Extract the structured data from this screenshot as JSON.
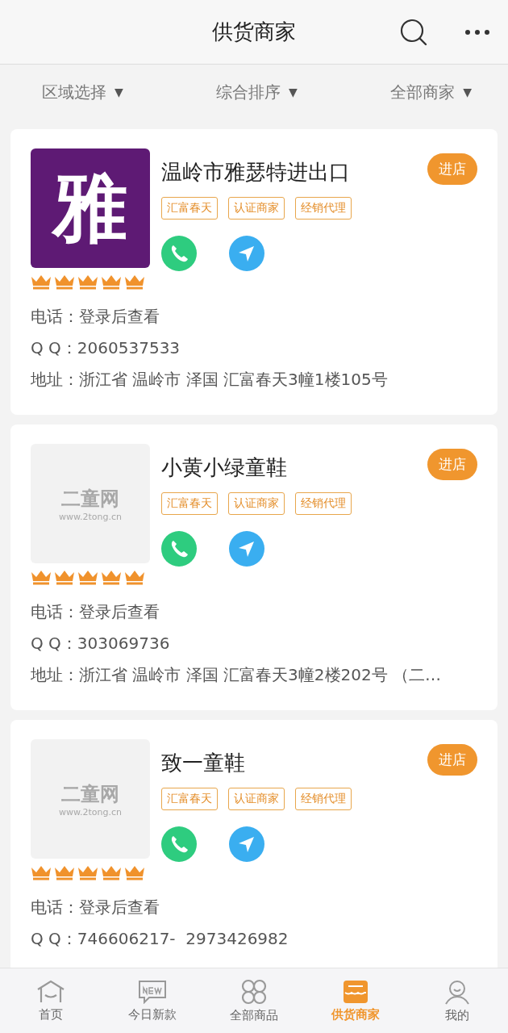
{
  "header": {
    "title": "供货商家"
  },
  "filters": [
    {
      "label": "区域选择",
      "arrow": "▼"
    },
    {
      "label": "综合排序",
      "arrow": "▼"
    },
    {
      "label": "全部商家",
      "arrow": "▼"
    }
  ],
  "shops": [
    {
      "logo": {
        "kind": "letter",
        "text": "雅",
        "color": "#5e1a74"
      },
      "name": "温岭市雅瑟特进出口",
      "enter": "进店",
      "tags": [
        "汇富春天",
        "认证商家",
        "经销代理"
      ],
      "stars": 5,
      "info": [
        {
          "label": "电话：",
          "value": "登录后查看"
        },
        {
          "label": "Q Q：",
          "value": "2060537533"
        },
        {
          "label": "地址：",
          "value": "浙江省 温岭市 泽国 汇富春天3幢1楼105号"
        }
      ]
    },
    {
      "logo": {
        "kind": "placeholder",
        "text": "二童网",
        "url": "www.2tong.cn"
      },
      "name": "小黄小绿童鞋",
      "enter": "进店",
      "tags": [
        "汇富春天",
        "认证商家",
        "经销代理"
      ],
      "stars": 5,
      "info": [
        {
          "label": "电话：",
          "value": "登录后查看"
        },
        {
          "label": "Q Q：",
          "value": "303069736"
        },
        {
          "label": "地址：",
          "value": "浙江省 温岭市 泽国 汇富春天3幢2楼202号 （二…"
        }
      ]
    },
    {
      "logo": {
        "kind": "placeholder",
        "text": "二童网",
        "url": "www.2tong.cn"
      },
      "name": "致一童鞋",
      "enter": "进店",
      "tags": [
        "汇富春天",
        "认证商家",
        "经销代理"
      ],
      "stars": 5,
      "info": [
        {
          "label": "电话：",
          "value": "登录后查看"
        },
        {
          "label": "Q Q：",
          "value": "746606217-  2973426982"
        }
      ]
    }
  ],
  "nav": [
    {
      "label": "首页",
      "kind": "home",
      "selected": false
    },
    {
      "label": "今日新款",
      "kind": "new",
      "selected": false
    },
    {
      "label": "全部商品",
      "kind": "grid",
      "selected": false
    },
    {
      "label": "供货商家",
      "kind": "shop",
      "selected": true
    },
    {
      "label": "我的",
      "kind": "user",
      "selected": false
    }
  ]
}
